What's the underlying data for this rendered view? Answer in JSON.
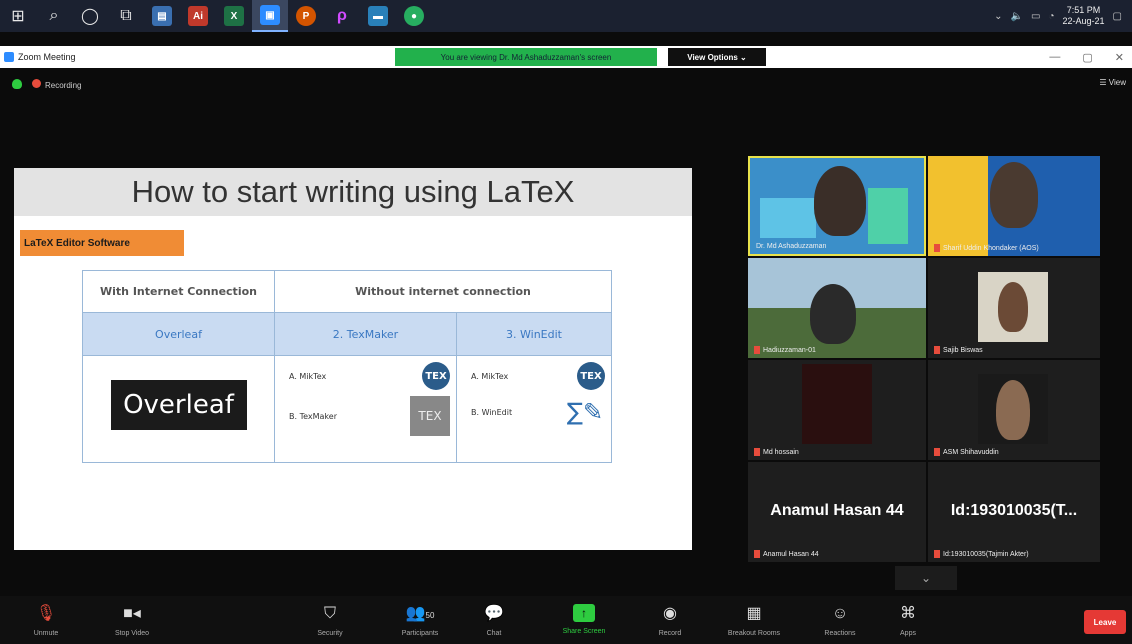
{
  "taskbar": {
    "clock_time": "7:51 PM",
    "clock_date": "22-Aug-21"
  },
  "titlebar": {
    "app_title": "Zoom Meeting",
    "viewing_banner": "You are viewing Dr. Md Ashaduzzaman's screen",
    "view_options": "View Options",
    "minimize": "—",
    "restore": "▢",
    "close": "✕"
  },
  "status": {
    "recording": "Recording",
    "view": "View"
  },
  "slide": {
    "heading": "How to start writing using LaTeX",
    "tag": "LaTeX Editor Software",
    "table": {
      "header_left": "With Internet Connection",
      "header_right": "Without internet connection",
      "col1": "Overleaf",
      "col2": "2. TexMaker",
      "col3": "3. WinEdit",
      "overleaf_logo": "Overleaf",
      "col2_a": "A. MikTex",
      "col2_b": "B. TexMaker",
      "col3_a": "A. MikTex",
      "col3_b": "B. WinEdit",
      "tex_badge": "TEX",
      "texmaker_badge": "TEX"
    }
  },
  "gallery": [
    {
      "name": "Dr. Md Ashaduzzaman",
      "muted": false
    },
    {
      "name": "Sharif Uddin Khondaker (AOS)",
      "muted": true
    },
    {
      "name": "Hadiuzzaman-01",
      "muted": true
    },
    {
      "name": "Sajib Biswas",
      "muted": true
    },
    {
      "name": "Md hossain",
      "muted": true
    },
    {
      "name": "ASM Shihavuddin",
      "muted": true
    },
    {
      "name": "Anamul Hasan 44",
      "muted": true,
      "big": "Anamul Hasan 44"
    },
    {
      "name": "Id:193010035(Tajmin Akter)",
      "muted": true,
      "big": "Id:193010035(T..."
    }
  ],
  "toolbar": {
    "unmute": "Unmute",
    "stop_video": "Stop Video",
    "security": "Security",
    "participants": "Participants",
    "participant_count": "50",
    "chat": "Chat",
    "share_screen": "Share Screen",
    "record": "Record",
    "breakout_rooms": "Breakout Rooms",
    "reactions": "Reactions",
    "apps": "Apps",
    "leave": "Leave"
  }
}
